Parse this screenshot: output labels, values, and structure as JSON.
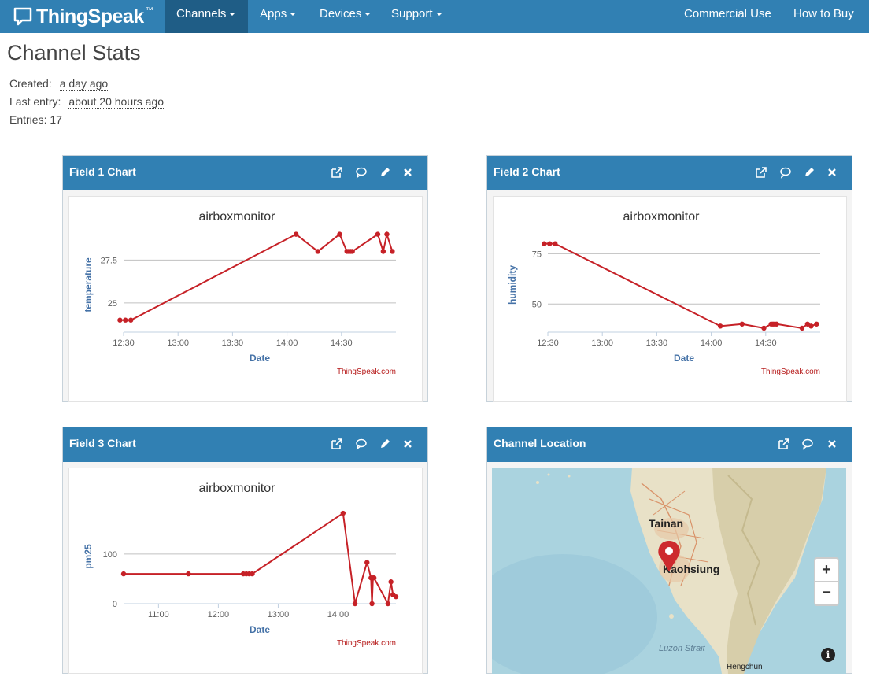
{
  "nav": {
    "brand": "ThingSpeak",
    "brand_tm": "™",
    "items": [
      {
        "label": "Channels",
        "dropdown": true,
        "active": true
      },
      {
        "label": "Apps",
        "dropdown": true
      },
      {
        "label": "Devices",
        "dropdown": true
      },
      {
        "label": "Support",
        "dropdown": true
      }
    ],
    "right_items": [
      {
        "label": "Commercial Use"
      },
      {
        "label": "How to Buy"
      }
    ]
  },
  "stats": {
    "title": "Channel Stats",
    "created_label": "Created:",
    "created_value": "a day ago",
    "last_entry_label": "Last entry:",
    "last_entry_value": "about 20 hours ago",
    "entries_text": "Entries: 17"
  },
  "panels": {
    "field1_title": "Field 1 Chart",
    "field2_title": "Field 2 Chart",
    "field3_title": "Field 3 Chart",
    "location_title": "Channel Location"
  },
  "colors": {
    "navbar": "#3180b3",
    "series": "#c62127",
    "axis_title": "#4572a7"
  },
  "chart_data": [
    {
      "type": "line",
      "title": "airboxmonitor",
      "xlabel": "Date",
      "ylabel": "temperature",
      "credit": "ThingSpeak.com",
      "x_ticks": [
        "12:30",
        "13:00",
        "13:30",
        "14:00",
        "14:30"
      ],
      "y_ticks": [
        25,
        27.5
      ],
      "xlim": [
        "12:30",
        "15:00"
      ],
      "ylim": [
        23.3,
        28.8
      ],
      "series": [
        {
          "x": [
            "12:28",
            "12:31",
            "12:34",
            "14:05",
            "14:17",
            "14:29",
            "14:33",
            "14:34",
            "14:35",
            "14:36",
            "14:50",
            "14:53",
            "14:55",
            "14:58"
          ],
          "y": [
            24.0,
            24.0,
            24.0,
            29.0,
            28.0,
            29.0,
            28.0,
            28.0,
            28.0,
            28.0,
            29.0,
            28.0,
            29.0,
            28.0
          ]
        }
      ]
    },
    {
      "type": "line",
      "title": "airboxmonitor",
      "xlabel": "Date",
      "ylabel": "humidity",
      "credit": "ThingSpeak.com",
      "x_ticks": [
        "12:30",
        "13:00",
        "13:30",
        "14:00",
        "14:30"
      ],
      "y_ticks": [
        50,
        75
      ],
      "xlim": [
        "12:30",
        "15:00"
      ],
      "ylim": [
        36,
        83
      ],
      "series": [
        {
          "x": [
            "12:28",
            "12:31",
            "12:34",
            "14:05",
            "14:17",
            "14:29",
            "14:33",
            "14:34",
            "14:35",
            "14:36",
            "14:50",
            "14:53",
            "14:55",
            "14:58"
          ],
          "y": [
            80,
            80,
            80,
            39,
            40,
            38,
            40,
            40,
            40,
            40,
            38,
            40,
            39,
            40
          ]
        }
      ]
    },
    {
      "type": "line",
      "title": "airboxmonitor",
      "xlabel": "Date",
      "ylabel": "pm25",
      "credit": "ThingSpeak.com",
      "x_ticks": [
        "11:00",
        "12:00",
        "13:00",
        "14:00"
      ],
      "y_ticks": [
        0,
        100
      ],
      "xlim": [
        "10:25",
        "14:58"
      ],
      "ylim": [
        0,
        190
      ],
      "series": [
        {
          "x": [
            "10:25",
            "11:30",
            "12:25",
            "12:28",
            "12:31",
            "12:34",
            "14:05",
            "14:17",
            "14:29",
            "14:33",
            "14:34",
            "14:35",
            "14:36",
            "14:50",
            "14:53",
            "14:55",
            "14:58"
          ],
          "y": [
            60,
            60,
            60,
            60,
            60,
            60,
            182,
            0,
            83,
            52,
            0,
            52,
            52,
            0,
            44,
            18,
            14
          ]
        }
      ]
    }
  ],
  "map": {
    "labels": {
      "tainan": "Tainan",
      "kaohsiung": "Kaohsiung",
      "luzon": "Luzon Strait",
      "hengchun": "Hengchun"
    },
    "zoom_in": "+",
    "zoom_out": "−",
    "info": "i"
  }
}
